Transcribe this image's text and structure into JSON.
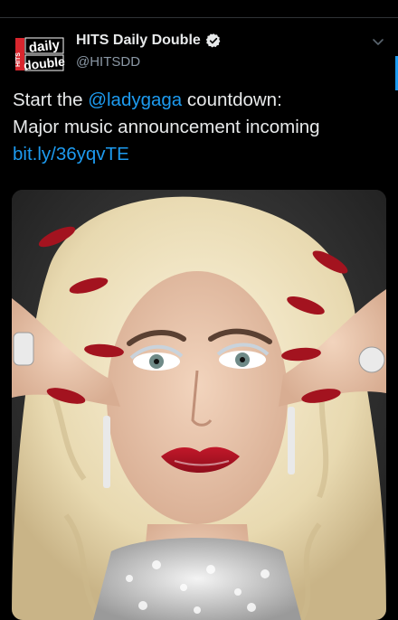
{
  "colors": {
    "background": "#000000",
    "text": "#e7e9ea",
    "secondary_text": "#8b98a5",
    "link": "#1d9bf0",
    "verified": "#e7e9ea"
  },
  "tweet": {
    "author": {
      "display_name": "HITS Daily Double",
      "handle": "@HITSDD",
      "verified": true,
      "avatar_icon": "hits-daily-double-logo",
      "avatar_logo_text": "daily double"
    },
    "text": {
      "line1_prefix": "Start the ",
      "mention": "@ladygaga",
      "line1_suffix": " countdown:",
      "line2": "Major music announcement incoming",
      "link": "bit.ly/36yqvTE"
    },
    "menu_icon": "chevron-down-icon",
    "media": {
      "type": "photo",
      "icon": "portrait-photo"
    }
  }
}
